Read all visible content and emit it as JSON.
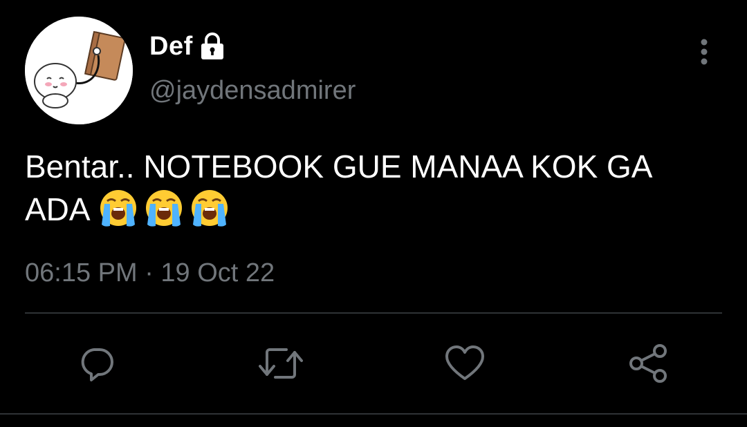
{
  "tweet": {
    "display_name": "Def",
    "handle": "@jaydensadmirer",
    "text": "Bentar.. NOTEBOOK GUE MANAA KOK GA ADA",
    "emojis": [
      "loudly-crying-face",
      "loudly-crying-face",
      "loudly-crying-face"
    ],
    "timestamp": "06:15 PM · 19 Oct 22"
  },
  "icons": {
    "lock": "lock-icon",
    "more": "more-vertical-icon",
    "reply": "reply-icon",
    "retweet": "retweet-icon",
    "like": "heart-icon",
    "share": "share-icon"
  },
  "colors": {
    "background": "#000000",
    "primary_text": "#ffffff",
    "secondary_text": "#71767b",
    "divider": "#2f3336"
  }
}
